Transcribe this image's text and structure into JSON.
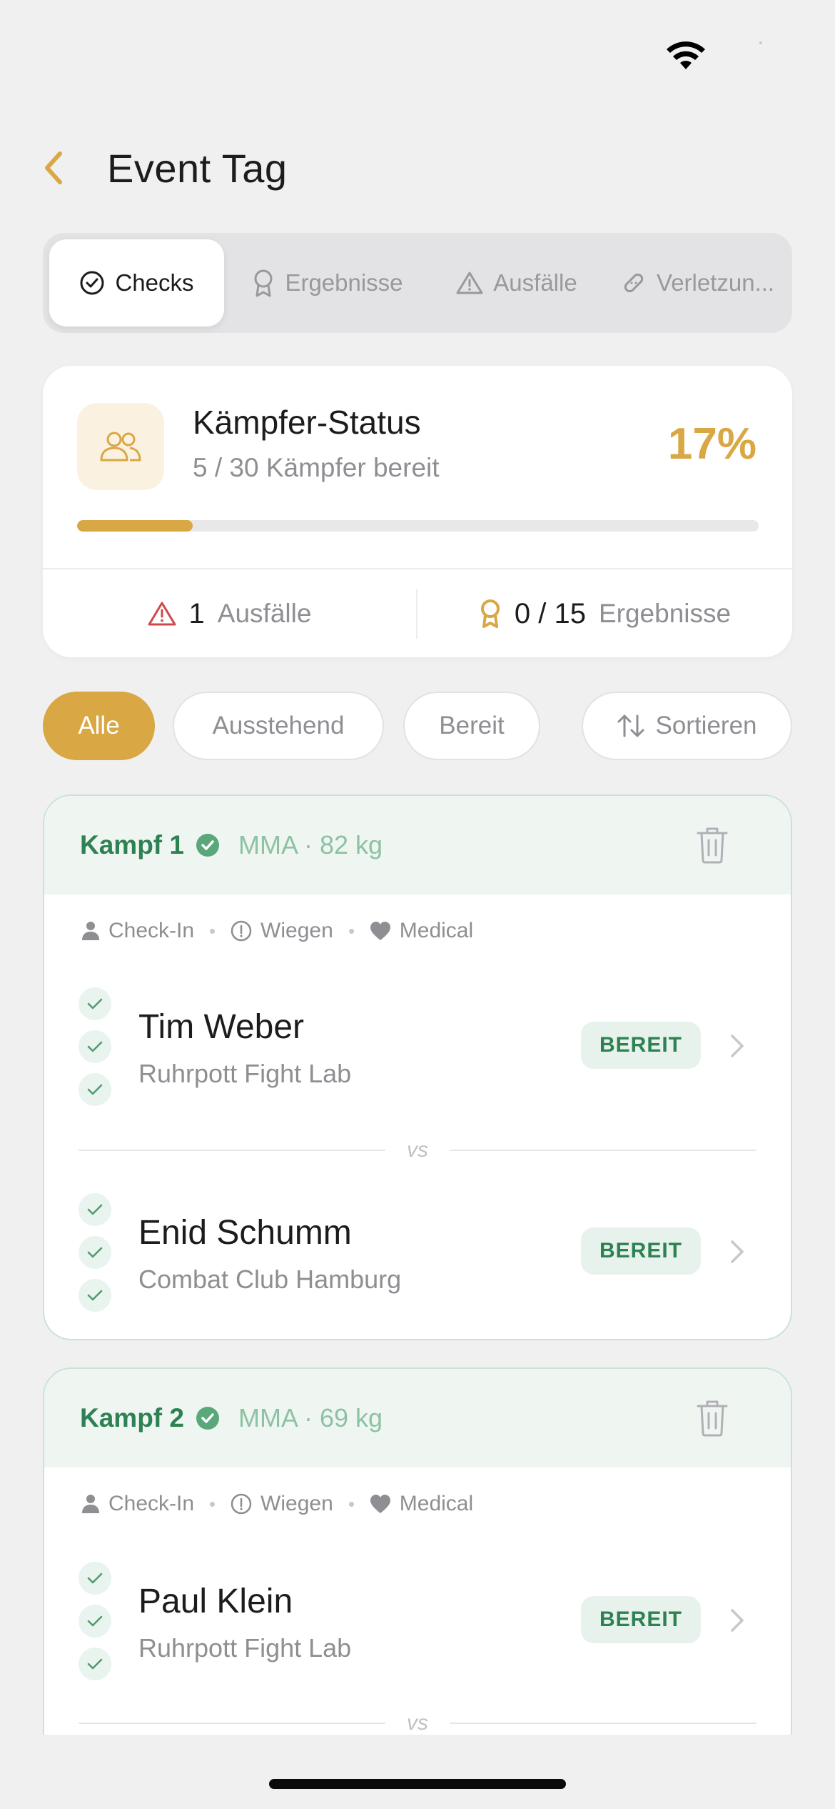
{
  "header": {
    "title": "Event Tag"
  },
  "tabs": [
    {
      "label": "Checks",
      "icon": "check-circle-icon",
      "active": true
    },
    {
      "label": "Ergebnisse",
      "icon": "award-icon",
      "active": false
    },
    {
      "label": "Ausfälle",
      "icon": "warning-icon",
      "active": false
    },
    {
      "label": "Verletzun...",
      "icon": "bandage-icon",
      "active": false
    }
  ],
  "status_card": {
    "title": "Kämpfer-Status",
    "subtitle": "5 / 30 Kämpfer bereit",
    "percent_label": "17%",
    "progress": 0.17,
    "dropouts": {
      "count": "1",
      "label": "Ausfälle"
    },
    "results": {
      "count": "0 / 15",
      "label": "Ergebnisse"
    }
  },
  "filters": {
    "all": "Alle",
    "pending": "Ausstehend",
    "ready": "Bereit",
    "sort": "Sortieren"
  },
  "legend": {
    "checkin": "Check-In",
    "weighin": "Wiegen",
    "medical": "Medical"
  },
  "fights": [
    {
      "name": "Kampf 1",
      "meta": "MMA · 82 kg",
      "vs": "vs",
      "fighters": [
        {
          "name": "Tim Weber",
          "club": "Ruhrpott Fight Lab",
          "status": "BEREIT"
        },
        {
          "name": "Enid Schumm",
          "club": "Combat Club Hamburg",
          "status": "BEREIT"
        }
      ]
    },
    {
      "name": "Kampf 2",
      "meta": "MMA · 69 kg",
      "vs": "vs",
      "fighters": [
        {
          "name": "Paul Klein",
          "club": "Ruhrpott Fight Lab",
          "status": "BEREIT"
        }
      ]
    }
  ],
  "colors": {
    "accent": "#d9a743",
    "success": "#2e8152",
    "danger": "#d0484b"
  }
}
